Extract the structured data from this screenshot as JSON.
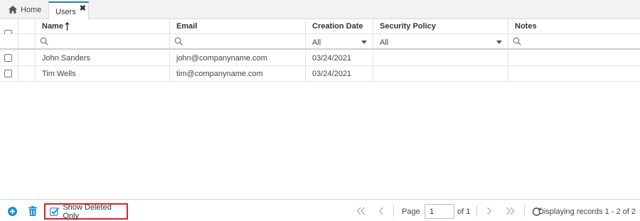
{
  "tabs": {
    "home_label": "Home",
    "users_label": "Users",
    "close_glyph": "✖"
  },
  "columns": {
    "name": "Name",
    "email": "Email",
    "creation_date": "Creation Date",
    "security_policy": "Security Policy",
    "notes": "Notes"
  },
  "filters": {
    "creation_date": "All",
    "security_policy": "All"
  },
  "rows": [
    {
      "name": "John Sanders",
      "email": "john@companyname.com",
      "creation_date": "03/24/2021",
      "security_policy": "",
      "notes": ""
    },
    {
      "name": "Tim Wells",
      "email": "tim@companyname.com",
      "creation_date": "03/24/2021",
      "security_policy": "",
      "notes": ""
    }
  ],
  "footer": {
    "show_deleted_label": "Show Deleted Only",
    "show_deleted_checked": true,
    "page_label": "Page",
    "page_value": "1",
    "of_label": "of 1",
    "displaying": "Displaying records 1 - 2 of 2"
  },
  "colors": {
    "accent": "#2a7fc1",
    "highlight_border": "#d4252b",
    "icon_blue": "#1f8bd6"
  }
}
